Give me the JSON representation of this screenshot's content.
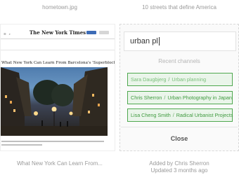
{
  "columns": {
    "left_title": "hometown.jpg",
    "right_title": "10 streets that define America"
  },
  "article": {
    "masthead": "The New York Times",
    "headline": "What New York Can Learn From Barcelona's 'Superblocks'",
    "photo_subject": "night street plaza in Barcelona"
  },
  "left_footer": "What New York Can Learn From...",
  "search": {
    "value": "urban pl"
  },
  "recent_channels_label": "Recent channels",
  "channels": [
    {
      "owner": "Sara Daugbjerg",
      "name": "Urban planning"
    },
    {
      "owner": "Chris Sherron",
      "name": "Urban Photography in Japan"
    },
    {
      "owner": "Lisa Cheng Smith",
      "name": "Radical Urbanist Projects"
    }
  ],
  "close_label": "Close",
  "right_footer": {
    "added_by": "Added by Chris Sherron",
    "updated": "Updated 3 months ago"
  },
  "colors": {
    "channel_border": "#4fa84f",
    "channel_bg": "#eaf5ea",
    "channel_text": "#3f9a3f"
  }
}
